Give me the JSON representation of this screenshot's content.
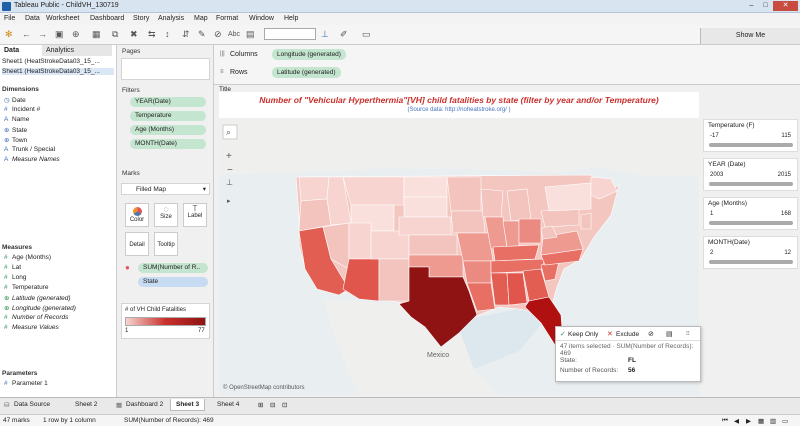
{
  "window": {
    "title": "Tableau Public - ChildVH_130719"
  },
  "menu": [
    "File",
    "Data",
    "Worksheet",
    "Dashboard",
    "Story",
    "Analysis",
    "Map",
    "Format",
    "Window",
    "Help"
  ],
  "toolbar": {
    "show_me": "Show Me",
    "abc": "Abc"
  },
  "data_pane": {
    "tabs": [
      "Data",
      "Analytics"
    ],
    "sources": [
      "Sheet1 (HeatStrokeData03_15_...",
      "Sheet1 (HeatStrokeData03_15_..."
    ],
    "dimensions_label": "Dimensions",
    "dimensions": [
      "Date",
      "Incident #",
      "Name",
      "State",
      "Town",
      "Trunk / Special",
      "Measure Names"
    ],
    "measures_label": "Measures",
    "measures": [
      "Age (Months)",
      "Lat",
      "Long",
      "Temperature",
      "Latitude (generated)",
      "Longitude (generated)",
      "Number of Records",
      "Measure Values"
    ],
    "parameters_label": "Parameters",
    "parameters": [
      "Parameter 1"
    ]
  },
  "cards": {
    "pages": "Pages",
    "filters": "Filters",
    "filter_pills": [
      "YEAR(Date)",
      "Temperature",
      "Age (Months)",
      "MONTH(Date)"
    ],
    "marks": "Marks",
    "mark_type": "Filled Map",
    "mark_buttons": [
      "Color",
      "Size",
      "Label",
      "Detail",
      "Tooltip"
    ],
    "mark_pills": [
      "SUM(Number of R..",
      "State"
    ],
    "legend_title": "# of VH Child Fatalities",
    "legend_min": "1",
    "legend_max": "77"
  },
  "shelves": {
    "columns_label": "Columns",
    "columns_pill": "Longitude (generated)",
    "rows_label": "Rows",
    "rows_pill": "Latitude (generated)"
  },
  "view": {
    "title_label": "Title",
    "chart_title": "Number of \"Vehicular Hyperthermia\"[VH] child fatalities by state (filter by year and/or Temperature)",
    "source_note": "(Source data: http://noheatstroke.org/ )",
    "mexico_label": "Mexico",
    "attribution": "© OpenStreetMap contributors"
  },
  "right_filters": [
    {
      "name": "Temperature (F)",
      "min": "-17",
      "max": "115"
    },
    {
      "name": "YEAR (Date)",
      "min": "2003",
      "max": "2015"
    },
    {
      "name": "Age (Months)",
      "min": "1",
      "max": "168"
    },
    {
      "name": "MONTH(Date)",
      "min": "2",
      "max": "12"
    }
  ],
  "tooltip": {
    "keep_only": "Keep Only",
    "exclude": "Exclude",
    "summary": "47 items selected · SUM(Number of Records): 469",
    "state_label": "State:",
    "state_value": "FL",
    "records_label": "Number of Records:",
    "records_value": "56"
  },
  "bottom_tabs": [
    "Data Source",
    "Sheet 2",
    "Dashboard 2",
    "Sheet 3",
    "Sheet 4"
  ],
  "status": {
    "marks": "47 marks",
    "rows_cols": "1 row by 1 column",
    "sum": "SUM(Number of Records): 469"
  },
  "colors": {
    "accent_red": "#c9302c",
    "map_high": "#8f1313",
    "map_low": "#f7d4d0"
  }
}
